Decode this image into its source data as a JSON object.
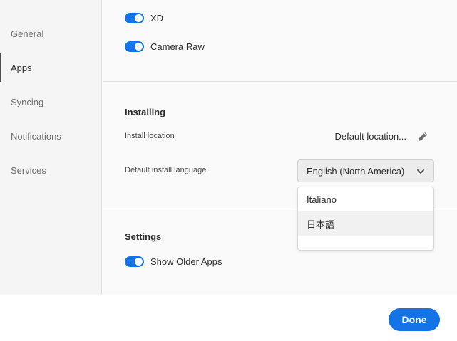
{
  "sidebar": {
    "items": [
      {
        "label": "General"
      },
      {
        "label": "Apps"
      },
      {
        "label": "Syncing"
      },
      {
        "label": "Notifications"
      },
      {
        "label": "Services"
      }
    ],
    "active": "Apps"
  },
  "apps": {
    "toggles": [
      {
        "label": "XD",
        "on": true
      },
      {
        "label": "Camera Raw",
        "on": true
      }
    ]
  },
  "installing": {
    "title": "Installing",
    "location_label": "Install location",
    "location_value": "Default location...",
    "edit_icon": "pencil-icon",
    "language_label": "Default install language",
    "language_selected": "English (North America)",
    "language_options": [
      "Italiano",
      "日本語"
    ]
  },
  "settings": {
    "title": "Settings",
    "toggles": [
      {
        "label": "Show Older Apps",
        "on": true
      }
    ]
  },
  "footer": {
    "done_label": "Done"
  },
  "colors": {
    "accent": "#1473e6",
    "sidebar_bg": "#f5f5f5",
    "text": "#2c2c2c"
  }
}
